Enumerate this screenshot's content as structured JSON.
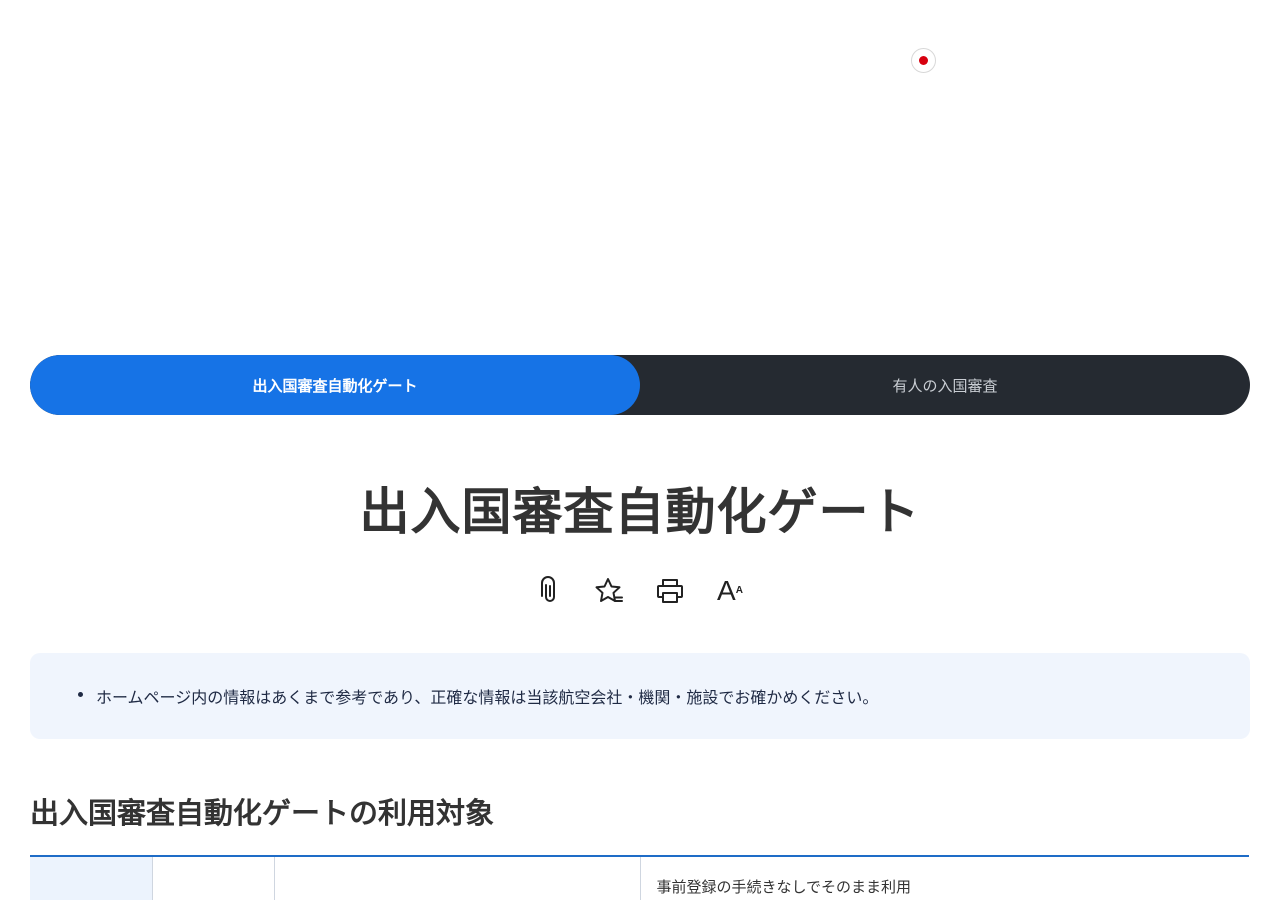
{
  "tabs": [
    {
      "label": "出入国審査自動化ゲート",
      "active": true
    },
    {
      "label": "有人の入国審査",
      "active": false
    }
  ],
  "page_title": "出入国審査自動化ゲート",
  "toolbar": {
    "icons": [
      "attachment-icon",
      "bookmark-star-icon",
      "print-icon",
      "font-size-icon"
    ],
    "font_size_large": "A",
    "font_size_small": "A"
  },
  "notice": {
    "items": [
      "ホームページ内の情報はあくまで参考であり、正確な情報は当該航空会社・機関・施設でお確かめください。"
    ]
  },
  "section": {
    "heading": "出入国審査自動化ゲートの利用対象"
  },
  "table": {
    "first_row_cells": [
      "",
      "",
      "",
      "事前登録の手続きなしでそのまま利用"
    ]
  },
  "colors": {
    "tab_active": "#1673e6",
    "tab_bar": "#252a31",
    "notice_bg": "#f0f5fd",
    "table_border": "#1e6cc7",
    "flag_red": "#d7000f"
  }
}
